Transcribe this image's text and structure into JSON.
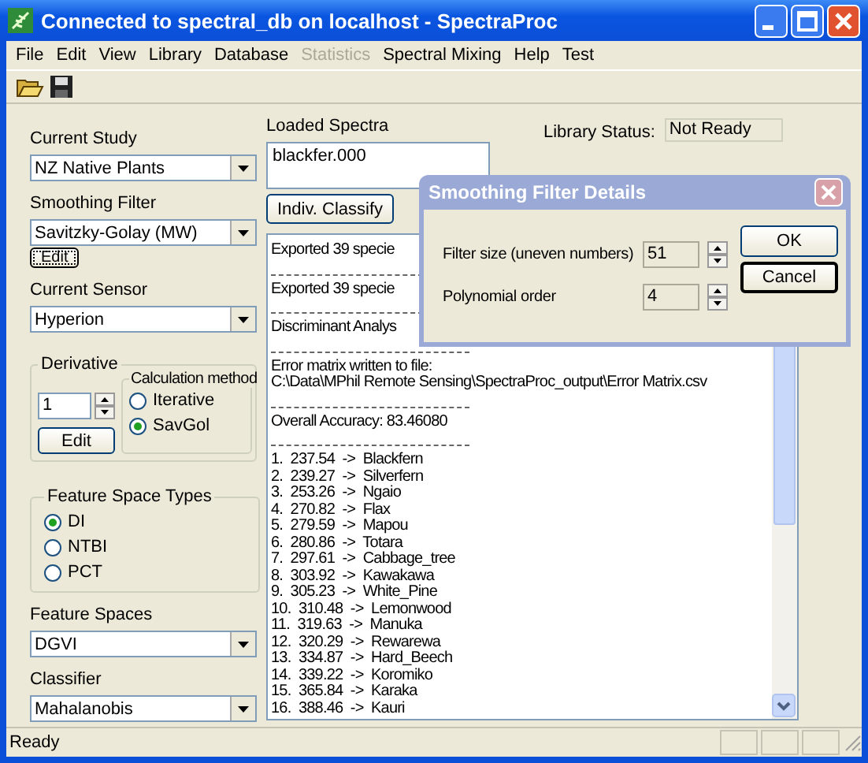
{
  "window": {
    "title": "Connected to spectral_db on localhost - SpectraProc"
  },
  "menu": [
    {
      "label": "File",
      "disabled": false
    },
    {
      "label": "Edit",
      "disabled": false
    },
    {
      "label": "View",
      "disabled": false
    },
    {
      "label": "Library",
      "disabled": false
    },
    {
      "label": "Database",
      "disabled": false
    },
    {
      "label": "Statistics",
      "disabled": true
    },
    {
      "label": "Spectral Mixing",
      "disabled": false
    },
    {
      "label": "Help",
      "disabled": false
    },
    {
      "label": "Test",
      "disabled": false
    }
  ],
  "left": {
    "study": {
      "label": "Current Study",
      "value": "NZ Native Plants"
    },
    "filter": {
      "label": "Smoothing Filter",
      "value": "Savitzky-Golay (MW)",
      "button": {
        "label": "Edit",
        "focused": true
      }
    },
    "sensor": {
      "label": "Current Sensor",
      "value": "Hyperion"
    },
    "derivative": {
      "title": "Derivative",
      "value": "1",
      "button": {
        "label": "Edit",
        "focused": false
      },
      "method": {
        "title": "Calculation method",
        "options": [
          {
            "label": "Iterative",
            "selected": false
          },
          {
            "label": "SavGol",
            "selected": true
          }
        ]
      }
    },
    "feature_space_types": {
      "title": "Feature Space Types",
      "options": [
        {
          "label": "DI",
          "selected": true
        },
        {
          "label": "NTBI",
          "selected": false
        },
        {
          "label": "PCT",
          "selected": false
        }
      ]
    },
    "feature_spaces": {
      "label": "Feature Spaces",
      "value": "DGVI"
    },
    "classifier": {
      "label": "Classifier",
      "value": "Mahalanobis"
    }
  },
  "loaded_spectra": {
    "label": "Loaded Spectra",
    "value": "blackfer.000"
  },
  "library_status": {
    "label": "Library Status:",
    "value": "Not Ready"
  },
  "classify_button": "Indiv. Classify",
  "log": [
    {
      "kind": "text",
      "text": "Exported 39 specie"
    },
    {
      "kind": "rule"
    },
    {
      "kind": "text",
      "text": "Exported 39 specie"
    },
    {
      "kind": "rule"
    },
    {
      "kind": "text",
      "text": "Discriminant Analys"
    },
    {
      "kind": "rule"
    },
    {
      "kind": "text",
      "text": "Error matrix written to file:"
    },
    {
      "kind": "text",
      "text": "C:\\Data\\MPhil Remote Sensing\\SpectraProc_output\\Error Matrix.csv"
    },
    {
      "kind": "rule"
    },
    {
      "kind": "text",
      "text": "Overall Accuracy: 83.46080"
    },
    {
      "kind": "rule"
    },
    {
      "kind": "text",
      "text": "1.  237.54  ->  Blackfern"
    },
    {
      "kind": "text",
      "text": "2.  239.27  ->  Silverfern"
    },
    {
      "kind": "text",
      "text": "3.  253.26  ->  Ngaio"
    },
    {
      "kind": "text",
      "text": "4.  270.82  ->  Flax"
    },
    {
      "kind": "text",
      "text": "5.  279.59  ->  Mapou"
    },
    {
      "kind": "text",
      "text": "6.  280.86  ->  Totara"
    },
    {
      "kind": "text",
      "text": "7.  297.61  ->  Cabbage_tree"
    },
    {
      "kind": "text",
      "text": "8.  303.92  ->  Kawakawa"
    },
    {
      "kind": "text",
      "text": "9.  305.23  ->  White_Pine"
    },
    {
      "kind": "text",
      "text": "10.  310.48  ->  Lemonwood"
    },
    {
      "kind": "text",
      "text": "11.  319.63  ->  Manuka"
    },
    {
      "kind": "text",
      "text": "12.  320.29  ->  Rewarewa"
    },
    {
      "kind": "text",
      "text": "13.  334.87  ->  Hard_Beech"
    },
    {
      "kind": "text",
      "text": "14.  339.22  ->  Koromiko"
    },
    {
      "kind": "text",
      "text": "15.  365.84  ->  Karaka"
    },
    {
      "kind": "text",
      "text": "16.  388.46  ->  Kauri"
    }
  ],
  "dialog": {
    "title": "Smoothing Filter Details",
    "fields": [
      {
        "label": "Filter size (uneven numbers)",
        "value": "51"
      },
      {
        "label": "Polynomial order",
        "value": "4"
      }
    ],
    "buttons": [
      {
        "label": "OK",
        "default": false
      },
      {
        "label": "Cancel",
        "default": true
      }
    ]
  },
  "status_bar": {
    "text": "Ready"
  }
}
